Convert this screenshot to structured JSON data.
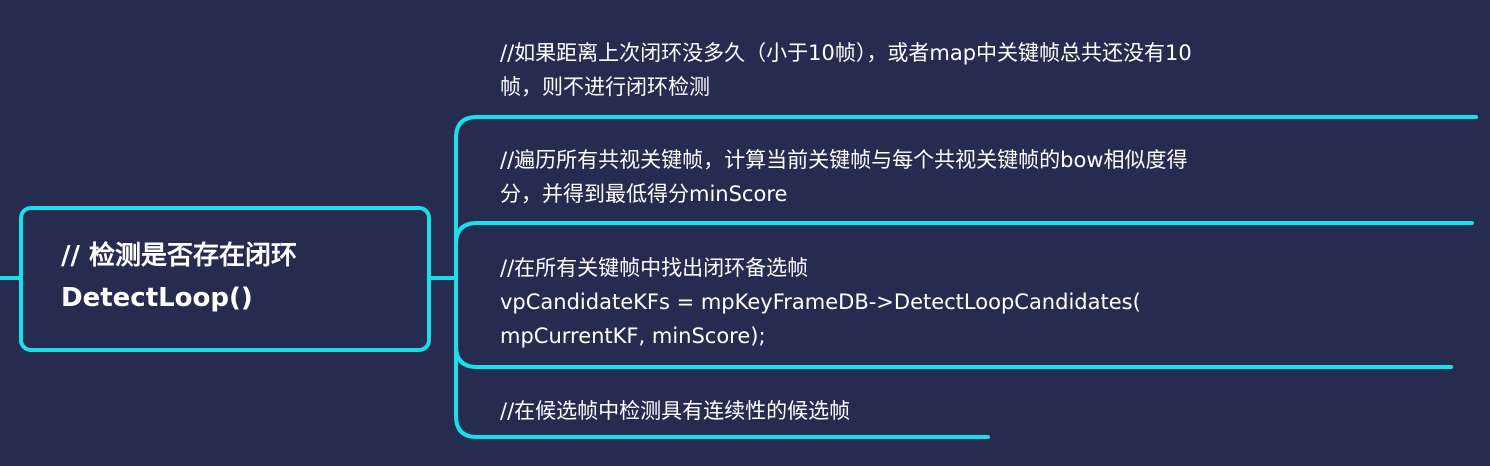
{
  "theme": {
    "background": "#252c4f",
    "accent": "#18e0e8",
    "text": "#ffffff"
  },
  "root": {
    "line1": "// 检测是否存在闭环",
    "line2": "DetectLoop()"
  },
  "children": [
    {
      "line1": "//如果距离上次闭环没多久（小于10帧），或者map中关键帧总共还没有10",
      "line2": "帧，则不进行闭环检测"
    },
    {
      "line1": "//遍历所有共视关键帧，计算当前关键帧与每个共视关键帧的bow相似度得",
      "line2": "分，并得到最低得分minScore"
    },
    {
      "line1": "//在所有关键帧中找出闭环备选帧",
      "line2": "vpCandidateKFs = mpKeyFrameDB->DetectLoopCandidates(",
      "line3": "mpCurrentKF, minScore);"
    },
    {
      "line1": "//在候选帧中检测具有连续性的候选帧"
    }
  ]
}
